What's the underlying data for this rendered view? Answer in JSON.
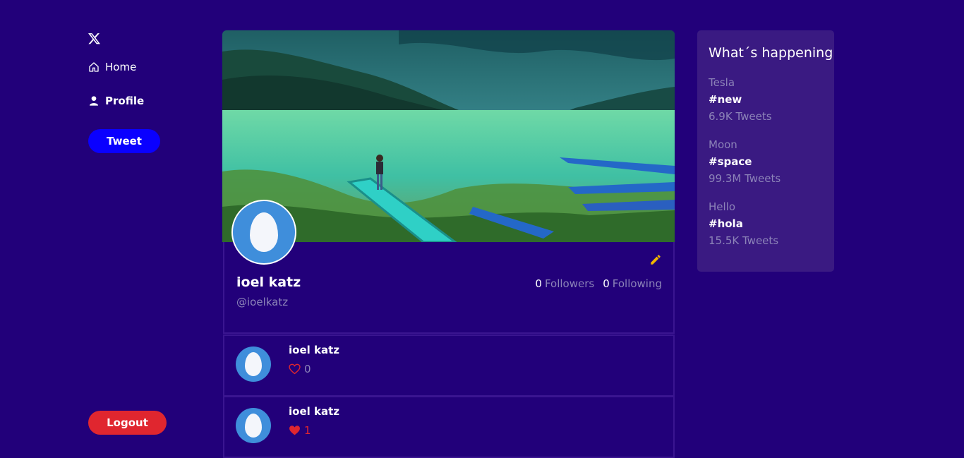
{
  "sidebar": {
    "logo_icon": "x-logo-icon",
    "nav": [
      {
        "label": "Home",
        "icon": "home-icon"
      },
      {
        "label": "Profile",
        "icon": "user-icon"
      }
    ],
    "tweet_label": "Tweet",
    "logout_label": "Logout"
  },
  "profile": {
    "name": "ioel katz",
    "handle": "@ioelkatz",
    "followers_count": "0",
    "followers_label": "Followers",
    "following_count": "0",
    "following_label": "Following"
  },
  "tweets": [
    {
      "author": "ioel katz",
      "likes": "0",
      "liked": false
    },
    {
      "author": "ioel katz",
      "likes": "1",
      "liked": true
    }
  ],
  "trends": {
    "title": "What´s happening",
    "items": [
      {
        "topic": "Tesla",
        "tag": "#new",
        "count": "6.9K Tweets"
      },
      {
        "topic": "Moon",
        "tag": "#space",
        "count": "99.3M Tweets"
      },
      {
        "topic": "Hello",
        "tag": "#hola",
        "count": "15.5K Tweets"
      }
    ]
  },
  "colors": {
    "background": "#22007a",
    "tweet_button": "#0a00ff",
    "logout_button": "#e0262f",
    "edit_icon": "#f2b600",
    "like_active": "#e0262f"
  }
}
